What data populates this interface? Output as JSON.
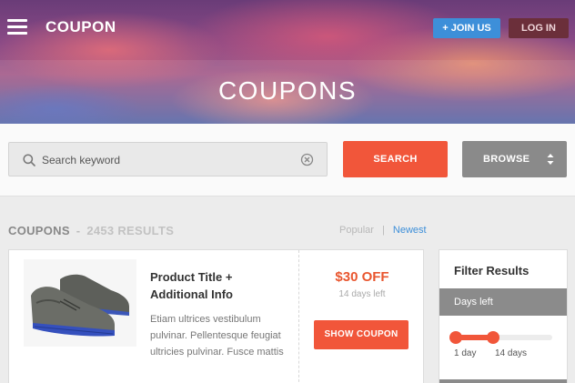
{
  "header": {
    "logo": "COUPON",
    "join_label": "+ JOIN US",
    "login_label": "LOG IN",
    "hero_title": "COUPONS"
  },
  "search": {
    "placeholder": "Search keyword",
    "search_label": "SEARCH",
    "browse_label": "BROWSE"
  },
  "results": {
    "title": "COUPONS",
    "separator": "-",
    "count": "2453 RESULTS",
    "sort_popular": "Popular",
    "sort_divider": "|",
    "sort_newest": "Newest"
  },
  "coupon": {
    "title": "Product Title + Additional Info",
    "description": "Etiam ultrices vestibulum pulvinar. Pellentesque feugiat ultricies pulvinar. Fusce mattis",
    "price": "$30 OFF",
    "days_left": "14 days left",
    "show_label": "SHOW COUPON"
  },
  "filter": {
    "title": "Filter Results",
    "section_label": "Days left",
    "slider_min_label": "1 day",
    "slider_max_label": "14 days",
    "slider_range_start": 0.0,
    "slider_range_end": 0.4
  },
  "colors": {
    "accent": "#f1563a",
    "link_blue": "#3d8fd9",
    "gray_button": "#8a8a8a"
  },
  "icons": [
    "menu-icon",
    "search-icon",
    "clear-icon",
    "updown-icon"
  ]
}
